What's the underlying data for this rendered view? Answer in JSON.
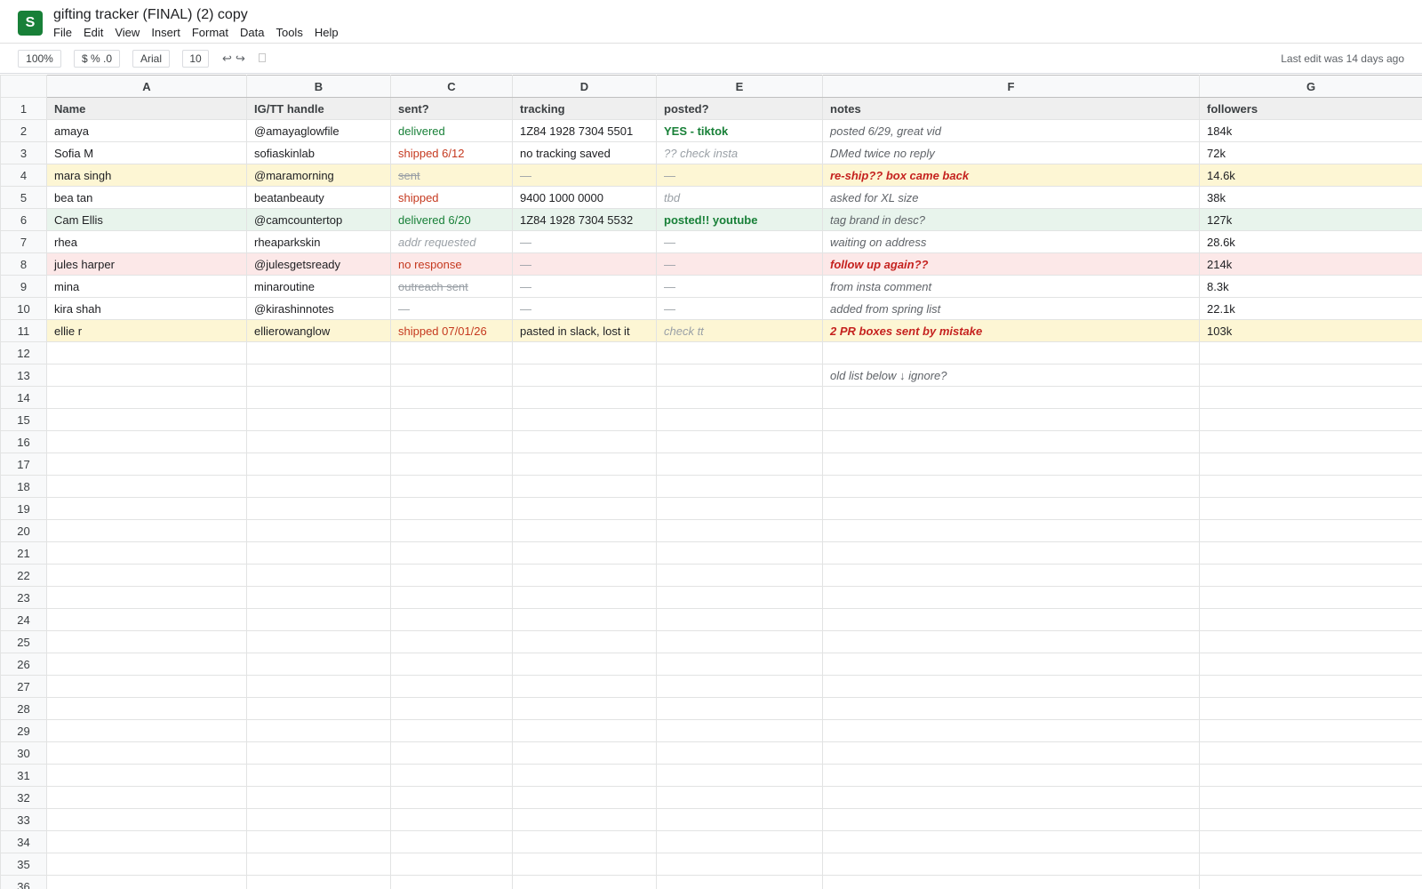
{
  "app": {
    "logo_letter": "S",
    "title": "gifting tracker (FINAL) (2) copy",
    "menu": [
      "File",
      "Edit",
      "View",
      "Insert",
      "Format",
      "Data",
      "Tools",
      "Help"
    ]
  },
  "toolbar": {
    "zoom": "100%",
    "number_format": "$ % .0",
    "font": "Arial",
    "font_size": "10",
    "undo": "↩",
    "redo": "↪",
    "last_edit": "Last edit was 14 days ago"
  },
  "columns": [
    "A",
    "B",
    "C",
    "D",
    "E",
    "F",
    "G"
  ],
  "header_row": [
    "Name",
    "IG/TT handle",
    "sent?",
    "tracking",
    "posted?",
    "notes",
    "followers"
  ],
  "rows": [
    {
      "num": "2",
      "bg": "",
      "cells": [
        {
          "text": "amaya",
          "style": ""
        },
        {
          "text": "@amayaglowfile",
          "style": ""
        },
        {
          "text": "delivered",
          "style": "green"
        },
        {
          "text": "1Z84 1928 7304 5501",
          "style": ""
        },
        {
          "text": "YES - tiktok",
          "style": "green bold"
        },
        {
          "text": "posted 6/29, great vid",
          "style": "gray-italic"
        },
        {
          "text": "184k",
          "style": ""
        }
      ]
    },
    {
      "num": "3",
      "bg": "",
      "cells": [
        {
          "text": "Sofia M",
          "style": ""
        },
        {
          "text": "sofiaskinlab",
          "style": ""
        },
        {
          "text": "shipped 6/12",
          "style": "orange"
        },
        {
          "text": "no tracking saved",
          "style": ""
        },
        {
          "text": "?? check insta",
          "style": "italic-muted"
        },
        {
          "text": "DMed twice no reply",
          "style": "gray-italic"
        },
        {
          "text": "72k",
          "style": ""
        }
      ]
    },
    {
      "num": "4",
      "bg": "bg-yellow",
      "cells": [
        {
          "text": "mara singh",
          "style": ""
        },
        {
          "text": "@maramorning",
          "style": ""
        },
        {
          "text": "sent",
          "style": "strike"
        },
        {
          "text": "—",
          "style": "muted"
        },
        {
          "text": "—",
          "style": "muted"
        },
        {
          "text": "re-ship?? box came back",
          "style": "bold-red-italic"
        },
        {
          "text": "14.6k",
          "style": ""
        }
      ]
    },
    {
      "num": "5",
      "bg": "",
      "cells": [
        {
          "text": "bea tan",
          "style": ""
        },
        {
          "text": "beatanbeauty",
          "style": ""
        },
        {
          "text": "shipped",
          "style": "orange"
        },
        {
          "text": "9400 1000 0000",
          "style": ""
        },
        {
          "text": "tbd",
          "style": "italic-muted"
        },
        {
          "text": "asked for XL size",
          "style": "gray-italic"
        },
        {
          "text": "38k",
          "style": ""
        }
      ]
    },
    {
      "num": "6",
      "bg": "bg-green",
      "cells": [
        {
          "text": "Cam Ellis",
          "style": ""
        },
        {
          "text": "@camcountertop",
          "style": ""
        },
        {
          "text": "delivered 6/20",
          "style": "green"
        },
        {
          "text": "1Z84 1928 7304 5532",
          "style": ""
        },
        {
          "text": "posted!! youtube",
          "style": "green bold"
        },
        {
          "text": "tag brand in desc?",
          "style": "gray-italic"
        },
        {
          "text": "127k",
          "style": ""
        }
      ]
    },
    {
      "num": "7",
      "bg": "",
      "cells": [
        {
          "text": "rhea",
          "style": ""
        },
        {
          "text": "rheaparkskin",
          "style": ""
        },
        {
          "text": "addr requested",
          "style": "italic-muted"
        },
        {
          "text": "—",
          "style": "muted"
        },
        {
          "text": "—",
          "style": "muted"
        },
        {
          "text": "waiting on address",
          "style": "gray-italic"
        },
        {
          "text": "28.6k",
          "style": ""
        }
      ]
    },
    {
      "num": "8",
      "bg": "bg-red",
      "cells": [
        {
          "text": "jules harper",
          "style": ""
        },
        {
          "text": "@julesgetsready",
          "style": ""
        },
        {
          "text": "no response",
          "style": "orange"
        },
        {
          "text": "—",
          "style": "muted"
        },
        {
          "text": "—",
          "style": "muted"
        },
        {
          "text": "follow up again??",
          "style": "bold-red-italic"
        },
        {
          "text": "214k",
          "style": ""
        }
      ]
    },
    {
      "num": "9",
      "bg": "",
      "cells": [
        {
          "text": "mina",
          "style": ""
        },
        {
          "text": "minaroutine",
          "style": ""
        },
        {
          "text": "outreach sent",
          "style": "strike"
        },
        {
          "text": "—",
          "style": "muted"
        },
        {
          "text": "—",
          "style": "muted"
        },
        {
          "text": "from insta comment",
          "style": "gray-italic"
        },
        {
          "text": "8.3k",
          "style": ""
        }
      ]
    },
    {
      "num": "10",
      "bg": "",
      "cells": [
        {
          "text": "kira shah",
          "style": ""
        },
        {
          "text": "@kirashinnotes",
          "style": ""
        },
        {
          "text": "—",
          "style": "muted"
        },
        {
          "text": "—",
          "style": "muted"
        },
        {
          "text": "—",
          "style": "muted"
        },
        {
          "text": "added from spring list",
          "style": "gray-italic"
        },
        {
          "text": "22.1k",
          "style": ""
        }
      ]
    },
    {
      "num": "11",
      "bg": "bg-yellow",
      "cells": [
        {
          "text": "ellie r",
          "style": ""
        },
        {
          "text": "ellierowanglow",
          "style": ""
        },
        {
          "text": "shipped 07/01/26",
          "style": "orange"
        },
        {
          "text": "pasted in slack, lost it",
          "style": ""
        },
        {
          "text": "check tt",
          "style": "italic-muted"
        },
        {
          "text": "2 PR boxes sent by mistake",
          "style": "bold-red-italic"
        },
        {
          "text": "103k",
          "style": ""
        }
      ]
    },
    {
      "num": "12",
      "bg": "",
      "cells": [
        {
          "text": "",
          "style": ""
        },
        {
          "text": "",
          "style": ""
        },
        {
          "text": "",
          "style": ""
        },
        {
          "text": "",
          "style": ""
        },
        {
          "text": "",
          "style": ""
        },
        {
          "text": "",
          "style": ""
        },
        {
          "text": "",
          "style": ""
        }
      ]
    },
    {
      "num": "13",
      "bg": "",
      "cells": [
        {
          "text": "",
          "style": ""
        },
        {
          "text": "",
          "style": ""
        },
        {
          "text": "",
          "style": ""
        },
        {
          "text": "",
          "style": ""
        },
        {
          "text": "",
          "style": ""
        },
        {
          "text": "old list below ↓ ignore?",
          "style": "gray-italic"
        },
        {
          "text": "",
          "style": ""
        }
      ]
    }
  ],
  "empty_row_numbers": [
    "14",
    "15",
    "16",
    "17",
    "18",
    "19",
    "20",
    "21",
    "22",
    "23",
    "24",
    "25",
    "26",
    "27",
    "28",
    "29",
    "30",
    "31",
    "32",
    "33",
    "34",
    "35",
    "36"
  ]
}
